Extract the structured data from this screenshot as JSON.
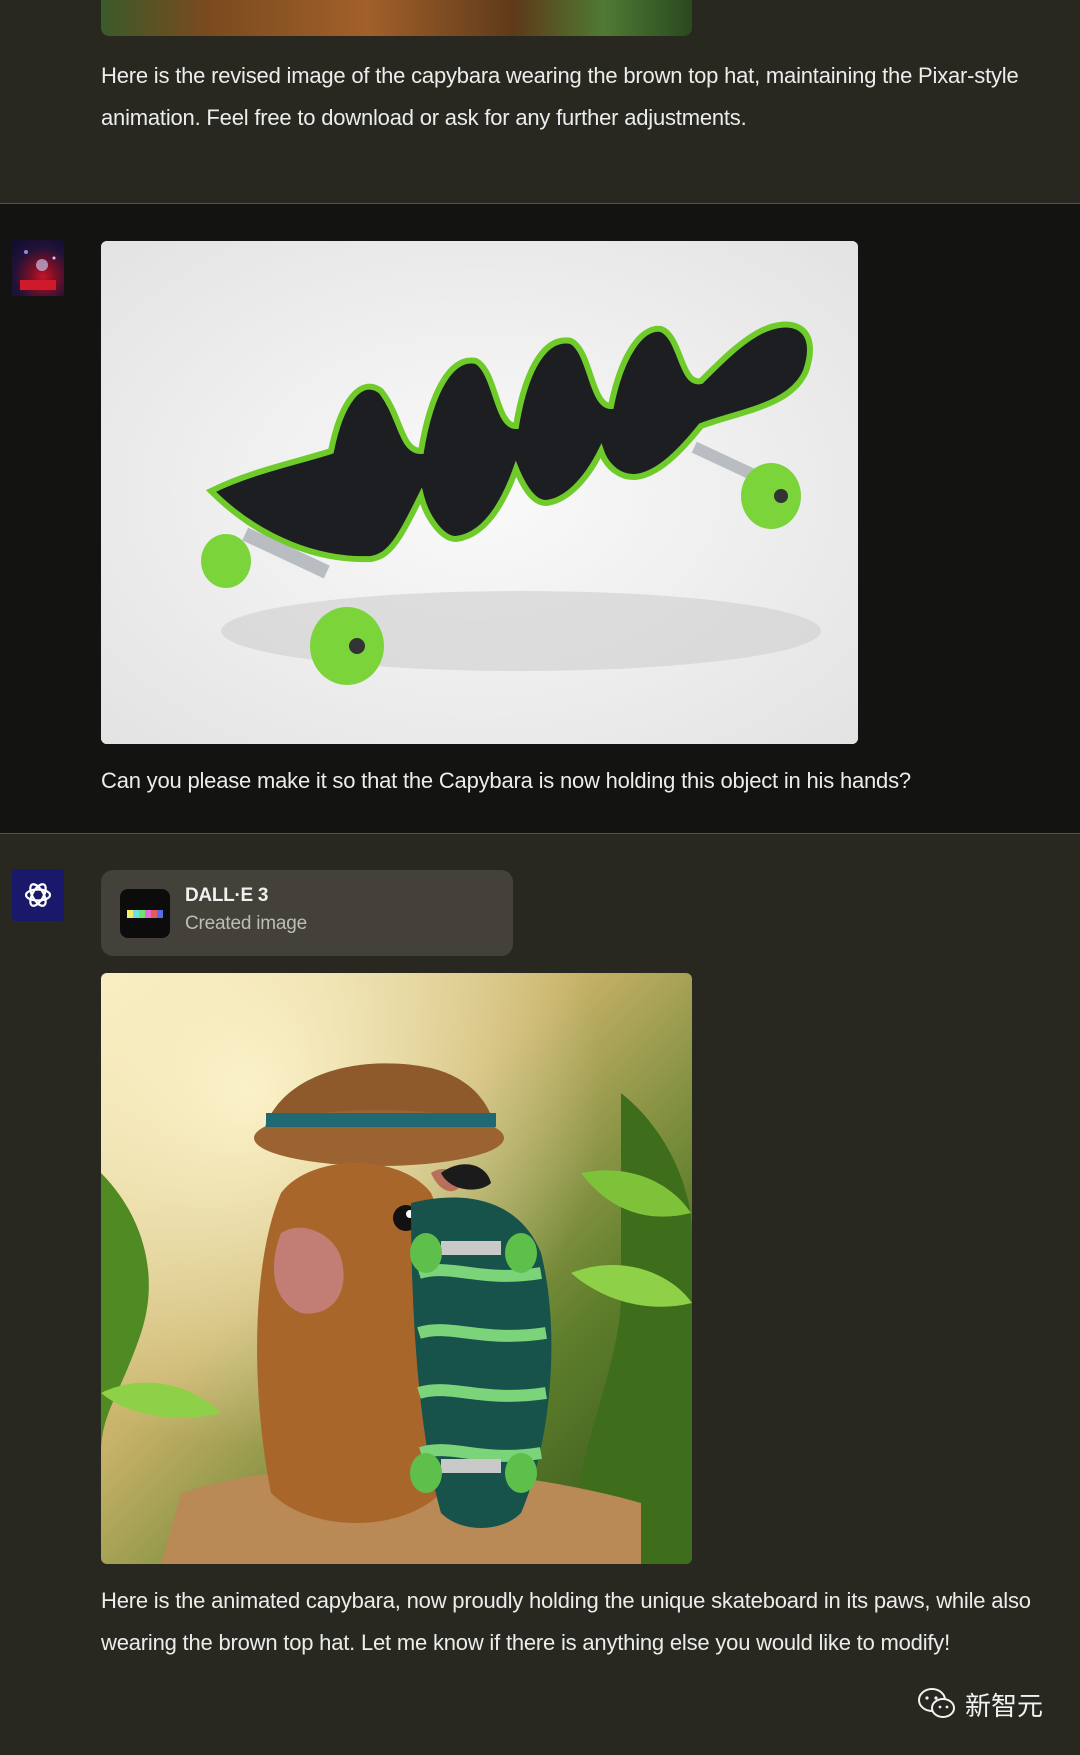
{
  "messages": {
    "first": {
      "text": "Here is the revised image of the capybara wearing the brown top hat, maintaining the Pixar-style animation. Feel free to download or ask for any further adjustments."
    },
    "user": {
      "text": "Can you please make it so that the Capybara is now holding this object in his hands?"
    },
    "assistant": {
      "tool": {
        "name": "DALL·E 3",
        "status": "Created image"
      },
      "text": "Here is the animated capybara, now proudly holding the unique skateboard in its paws, while also wearing the brown top hat. Let me know if there is anything else you would like to modify!"
    }
  },
  "watermark": {
    "text": "新智元",
    "icon": "wechat-icon"
  },
  "colors": {
    "assistant_bg": "#282821",
    "user_bg": "#131312",
    "gpt_avatar_bg": "#19186a",
    "card_bg": "#434139"
  }
}
